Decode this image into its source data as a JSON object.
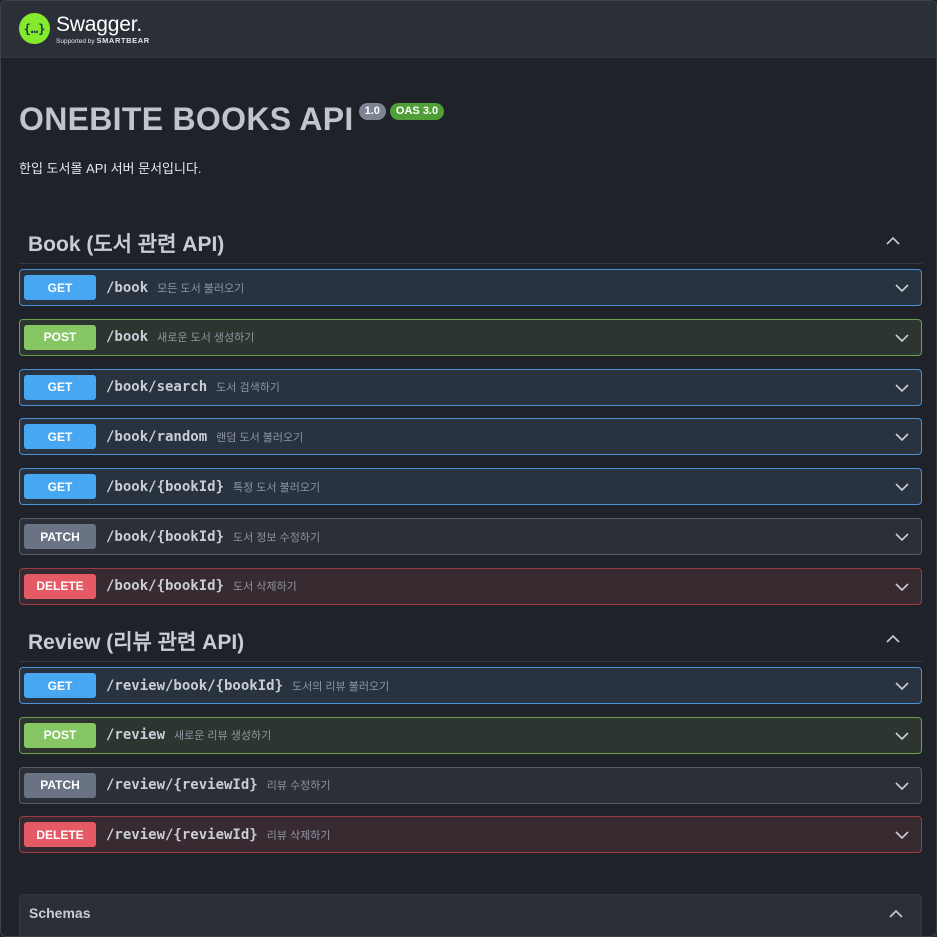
{
  "header": {
    "logo_icon": "{…}",
    "logo_name": "Swagger.",
    "logo_sub_prefix": "Supported by ",
    "logo_sub_brand": "SMARTBEAR"
  },
  "info": {
    "title": "ONEBITE BOOKS API",
    "version": "1.0",
    "oas": "OAS 3.0",
    "description": "한입 도서몰 API 서버 문서입니다."
  },
  "sections": [
    {
      "title": "Book (도서 관련 API)",
      "ops": [
        {
          "method": "GET",
          "path": "/book",
          "summary": "모든 도서 불러오기"
        },
        {
          "method": "POST",
          "path": "/book",
          "summary": "새로운 도서 생성하기"
        },
        {
          "method": "GET",
          "path": "/book/search",
          "summary": "도서 검색하기"
        },
        {
          "method": "GET",
          "path": "/book/random",
          "summary": "랜덤 도서 불러오기"
        },
        {
          "method": "GET",
          "path": "/book/{bookId}",
          "summary": "특정 도서 불러오기"
        },
        {
          "method": "PATCH",
          "path": "/book/{bookId}",
          "summary": "도서 정보 수정하기"
        },
        {
          "method": "DELETE",
          "path": "/book/{bookId}",
          "summary": "도서 삭제하기"
        }
      ]
    },
    {
      "title": "Review (리뷰 관련 API)",
      "ops": [
        {
          "method": "GET",
          "path": "/review/book/{bookId}",
          "summary": "도서의 리뷰 불러오기"
        },
        {
          "method": "POST",
          "path": "/review",
          "summary": "새로운 리뷰 생성하기"
        },
        {
          "method": "PATCH",
          "path": "/review/{reviewId}",
          "summary": "리뷰 수정하기"
        },
        {
          "method": "DELETE",
          "path": "/review/{reviewId}",
          "summary": "리뷰 삭제하기"
        }
      ]
    }
  ],
  "schemas": {
    "title": "Schemas"
  },
  "colors": {
    "get": "#47a7f3",
    "post": "#86c665",
    "patch": "#6a7384",
    "delete": "#e55a65",
    "logo": "#85ea2d"
  },
  "icons": {
    "section_toggle": "chevron-up-icon",
    "op_toggle": "chevron-down-icon"
  }
}
